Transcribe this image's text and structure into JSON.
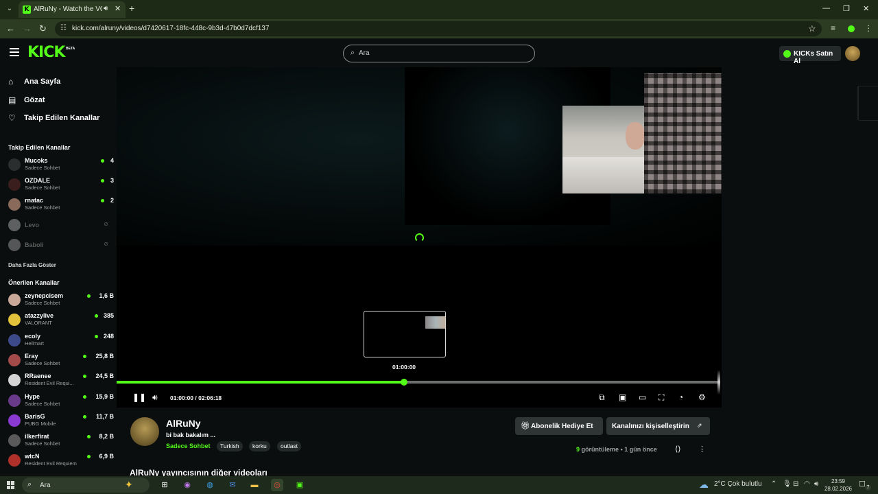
{
  "browser": {
    "tab_title": "AlRuNy - Watch the VOD o",
    "url": "kick.com/alruny/videos/d7420617-18fc-448c-9b3d-47b0d7dcf137"
  },
  "header": {
    "logo": "KICK",
    "logo_badge": "BETA",
    "search_placeholder": "Ara",
    "kicks_button": "KICKs Satın Al"
  },
  "sidebar": {
    "nav": [
      {
        "label": "Ana Sayfa",
        "icon": "home-icon"
      },
      {
        "label": "Gözat",
        "icon": "browse-icon"
      },
      {
        "label": "Takip Edilen Kanallar",
        "icon": "heart-icon"
      }
    ],
    "followed_heading": "Takip Edilen Kanallar",
    "followed": [
      {
        "name": "Mucoks",
        "category": "Sadece Sohbet",
        "viewers": "4",
        "live": true,
        "avatar_color": "#2a2e2f"
      },
      {
        "name": "OZDALE",
        "category": "Sadece Sohbet",
        "viewers": "3",
        "live": true,
        "avatar_color": "#3a1d1d"
      },
      {
        "name": "rnatac",
        "category": "Sadece Sohbet",
        "viewers": "2",
        "live": true,
        "avatar_color": "#8a6a5a"
      },
      {
        "name": "Levo",
        "category": "",
        "viewers": "",
        "live": false,
        "avatar_color": "#c4c4c4"
      },
      {
        "name": "Baboli",
        "category": "",
        "viewers": "",
        "live": false,
        "avatar_color": "#b0b0b0"
      }
    ],
    "show_more": "Daha Fazla Göster",
    "recommended_heading": "Önerilen Kanallar",
    "recommended": [
      {
        "name": "zeynepcisem",
        "category": "Sadece Sohbet",
        "viewers": "1,6 B",
        "avatar_color": "#c9a89a"
      },
      {
        "name": "atazzylive",
        "category": "VALORANT",
        "viewers": "385",
        "avatar_color": "#e2c23a"
      },
      {
        "name": "ecoly",
        "category": "Hellmart",
        "viewers": "248",
        "avatar_color": "#3c4a8a"
      },
      {
        "name": "Eray",
        "category": "Sadece Sohbet",
        "viewers": "25,8 B",
        "avatar_color": "#a34a4a"
      },
      {
        "name": "RRaenee",
        "category": "Resident Evil Requi...",
        "viewers": "24,5 B",
        "avatar_color": "#d4d4d4"
      },
      {
        "name": "Hype",
        "category": "Sadece Sohbet",
        "viewers": "15,9 B",
        "avatar_color": "#6a3a8a"
      },
      {
        "name": "BarisG",
        "category": "PUBG Mobile",
        "viewers": "11,7 B",
        "avatar_color": "#8a3ad0"
      },
      {
        "name": "ilkerfirat",
        "category": "Sadece Sohbet",
        "viewers": "8,2 B",
        "avatar_color": "#5a5a5a"
      },
      {
        "name": "wtcN",
        "category": "Resident Evil Requiem",
        "viewers": "6,9 B",
        "avatar_color": "#b0302a"
      }
    ]
  },
  "player": {
    "hover_time": "01:00:00",
    "current_time": "01:00:00",
    "duration": "02:06:18",
    "progress": 0.477,
    "accent": "#53fc18"
  },
  "channel": {
    "name": "AlRuNy",
    "title": "bi bak bakalım ...",
    "category": "Sadece Sohbet",
    "tags": [
      "Turkish",
      "korku",
      "outlast"
    ],
    "gift_button": "Abonelik Hediye Et",
    "customize_button": "Kanalınızı kişiselleştirin",
    "views_count": "9",
    "views_label": "görüntüleme",
    "separator": "•",
    "age": "1 gün önce",
    "more_videos_heading": "AlRuNy yayıncısının diğer videoları"
  },
  "taskbar": {
    "search_label": "Ara",
    "weather": "2°C  Çok bulutlu",
    "time": "23:59",
    "date": "28.02.2026",
    "notifications": "7"
  }
}
